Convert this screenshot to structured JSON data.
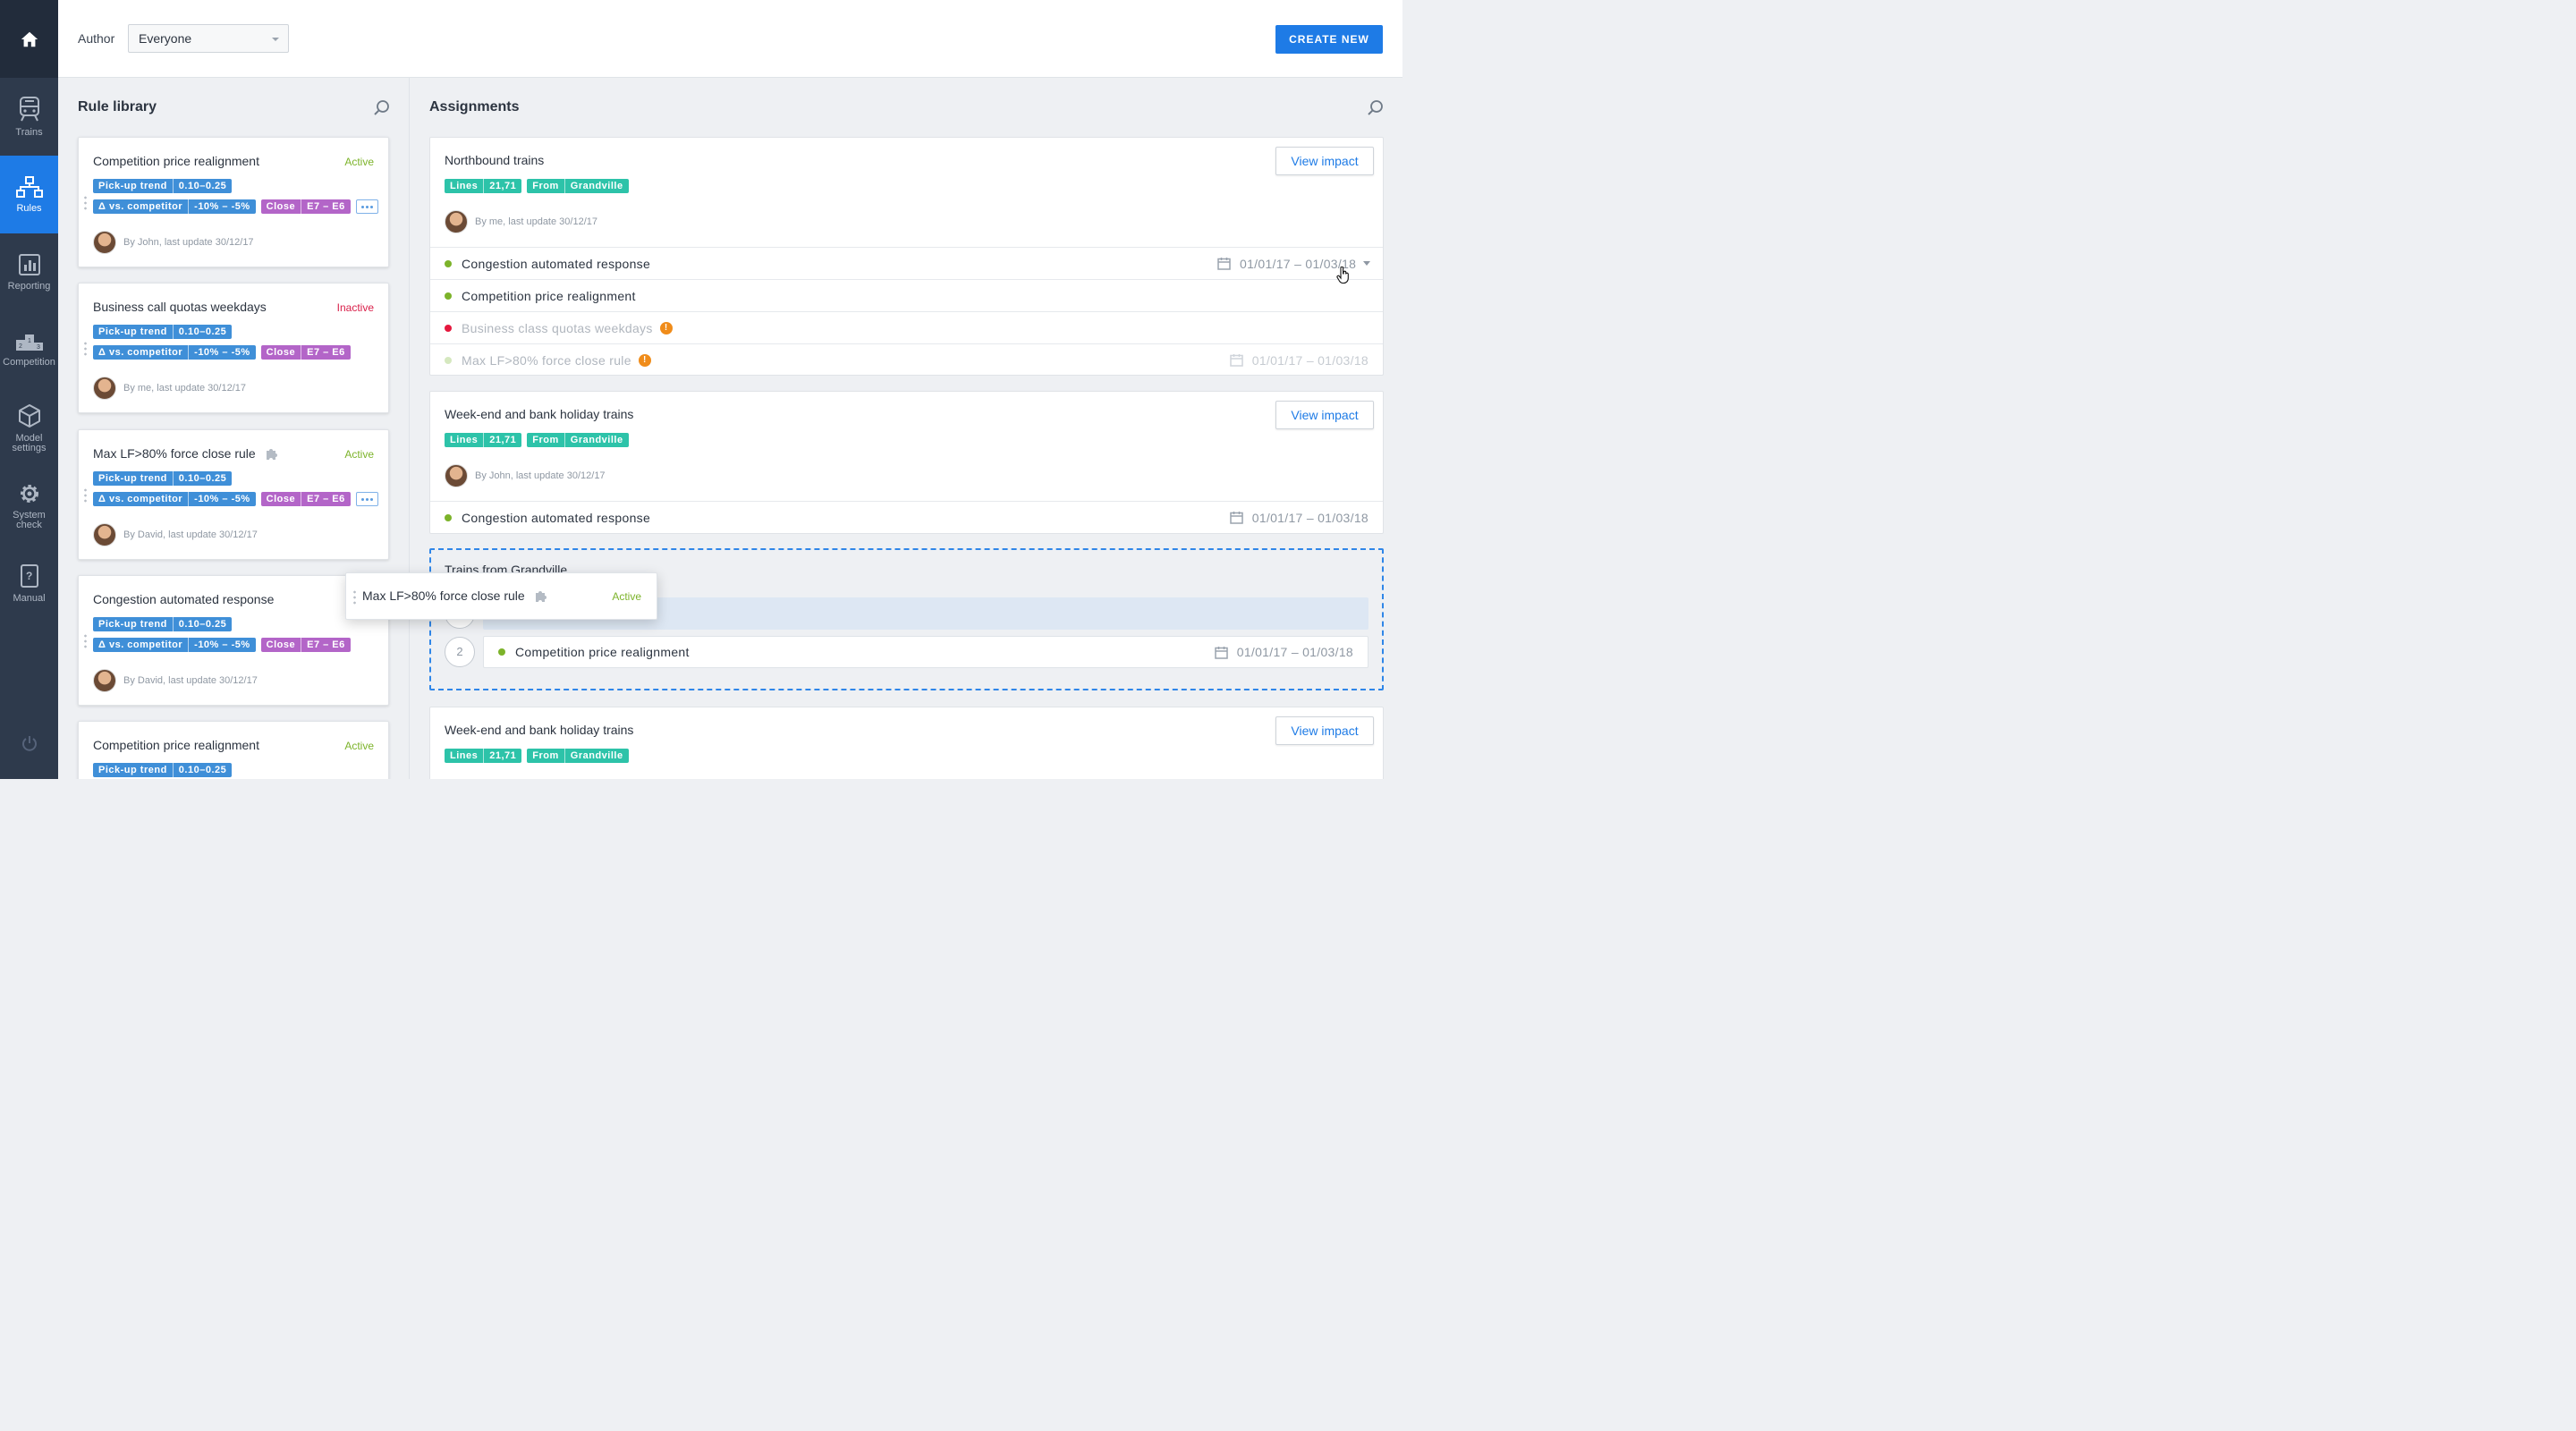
{
  "sidebar": {
    "items": [
      {
        "label": "Trains",
        "icon": "train-icon"
      },
      {
        "label": "Rules",
        "icon": "rules-icon",
        "active": true
      },
      {
        "label": "Reporting",
        "icon": "reporting-icon"
      },
      {
        "label": "Competition",
        "icon": "podium-icon"
      },
      {
        "label": "Model settings",
        "icon": "cube-icon"
      },
      {
        "label": "System check",
        "icon": "gear-icon"
      },
      {
        "label": "Manual",
        "icon": "manual-icon"
      }
    ]
  },
  "header": {
    "author_label": "Author",
    "author_value": "Everyone",
    "create_label": "CREATE NEW"
  },
  "library": {
    "title": "Rule library",
    "cards": [
      {
        "title": "Competition price realignment",
        "status": "Active",
        "t1a": "Pick-up trend",
        "t1b": "0.10–0.25",
        "t2a": "Δ vs. competitor",
        "t2b": "-10% – -5%",
        "t3a": "Close",
        "t3b": "E7 – E6",
        "byline": "By John, last update 30/12/17"
      },
      {
        "title": "Business call quotas weekdays",
        "status": "Inactive",
        "t1a": "Pick-up trend",
        "t1b": "0.10–0.25",
        "t2a": "Δ vs. competitor",
        "t2b": "-10% – -5%",
        "t3a": "Close",
        "t3b": "E7 – E6",
        "byline": "By me, last update 30/12/17"
      },
      {
        "title": "Max LF>80% force close rule",
        "status": "Active",
        "t1a": "Pick-up trend",
        "t1b": "0.10–0.25",
        "t2a": "Δ vs. competitor",
        "t2b": "-10% – -5%",
        "t3a": "Close",
        "t3b": "E7 – E6",
        "byline": "By David, last update 30/12/17"
      },
      {
        "title": "Congestion automated response",
        "status": "",
        "t1a": "Pick-up trend",
        "t1b": "0.10–0.25",
        "t2a": "Δ vs. competitor",
        "t2b": "-10% – -5%",
        "t3a": "Close",
        "t3b": "E7 – E6",
        "byline": "By David, last update 30/12/17"
      },
      {
        "title": "Competition price realignment",
        "status": "Active",
        "t1a": "Pick-up trend",
        "t1b": "0.10–0.25"
      }
    ]
  },
  "assignments": {
    "title": "Assignments",
    "view_impact": "View impact",
    "tag_lines": "Lines",
    "tag_lines_val": "21,71",
    "tag_from": "From",
    "tag_from_val": "Grandville",
    "cards": [
      {
        "title": "Northbound trains",
        "byline": "By me, last update 30/12/17",
        "rows": [
          {
            "name": "Congestion automated response",
            "dates": "01/01/17 – 01/03/18"
          },
          {
            "name": "Competition price realignment"
          },
          {
            "name": "Business class quotas weekdays",
            "warn": "!"
          },
          {
            "name": "Max LF>80% force close rule",
            "warn": "!",
            "dates": "01/01/17 – 01/03/18"
          }
        ]
      },
      {
        "title": "Week-end and bank holiday trains",
        "byline": "By John, last update 30/12/17",
        "rows": [
          {
            "name": "Congestion automated response",
            "dates": "01/01/17 – 01/03/18"
          }
        ]
      },
      {
        "title": "Week-end and bank holiday trains"
      }
    ],
    "dropzone": {
      "title": "Trains from Grandville",
      "num2": "2",
      "row_name": "Competition price realignment",
      "row_dates": "01/01/17 – 01/03/18"
    }
  },
  "drag": {
    "title": "Max LF>80% force close rule",
    "status": "Active"
  },
  "colors": {
    "accent": "#1e7be6",
    "sidebar": "#2e3a4c",
    "active_green": "#7cb32a",
    "inactive_red": "#d9204a",
    "tag_blue": "#3f8fd8",
    "tag_purple": "#b365c8",
    "tag_teal": "#2dc3a9",
    "warn_orange": "#f08c1a"
  }
}
